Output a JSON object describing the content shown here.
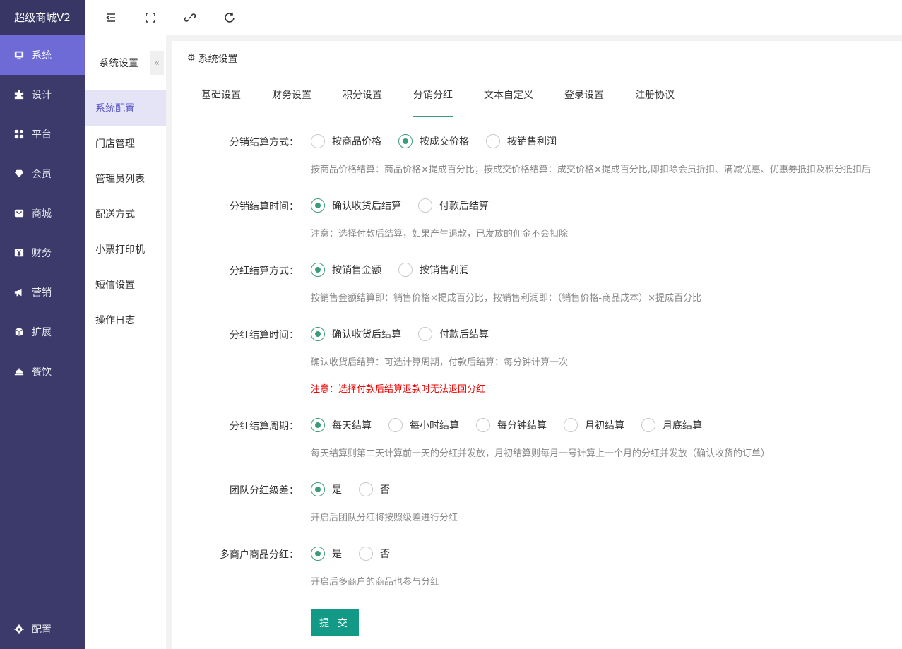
{
  "app": {
    "brand": "超级商城V2"
  },
  "sidebar": {
    "items": [
      {
        "label": "系统",
        "icon": "monitor-icon"
      },
      {
        "label": "设计",
        "icon": "puzzle-icon"
      },
      {
        "label": "平台",
        "icon": "grid-icon"
      },
      {
        "label": "会员",
        "icon": "diamond-icon"
      },
      {
        "label": "商城",
        "icon": "cart-icon"
      },
      {
        "label": "财务",
        "icon": "yen-icon"
      },
      {
        "label": "营销",
        "icon": "megaphone-icon"
      },
      {
        "label": "扩展",
        "icon": "cube-icon"
      },
      {
        "label": "餐饮",
        "icon": "dish-icon"
      }
    ],
    "bottom": {
      "label": "配置",
      "icon": "gear-icon"
    },
    "active_index": 0
  },
  "topbar": {
    "icons": [
      "menu-fold-icon",
      "fullscreen-icon",
      "link-icon",
      "refresh-icon"
    ]
  },
  "submenu": {
    "title": "系统设置",
    "collapse": "«",
    "items": [
      "系统配置",
      "门店管理",
      "管理员列表",
      "配送方式",
      "小票打印机",
      "短信设置",
      "操作日志"
    ],
    "active_index": 0
  },
  "panel": {
    "title": "系统设置",
    "tabs": [
      "基础设置",
      "财务设置",
      "积分设置",
      "分销分红",
      "文本自定义",
      "登录设置",
      "注册协议"
    ],
    "active_tab": 3
  },
  "form": {
    "rows": [
      {
        "label": "分销结算方式：",
        "options": [
          "按商品价格",
          "按成交价格",
          "按销售利润"
        ],
        "selected": 1,
        "hint": "按商品价格结算：商品价格×提成百分比；按成交价格结算：成交价格×提成百分比,即扣除会员折扣、满减优惠、优惠券抵扣及积分抵扣后"
      },
      {
        "label": "分销结算时间：",
        "options": [
          "确认收货后结算",
          "付款后结算"
        ],
        "selected": 0,
        "hint": "注意：选择付款后结算，如果产生退款，已发放的佣金不会扣除"
      },
      {
        "label": "分红结算方式：",
        "options": [
          "按销售金额",
          "按销售利润"
        ],
        "selected": 0,
        "hint": "按销售金额结算即：销售价格×提成百分比，按销售利润即：（销售价格-商品成本）×提成百分比"
      },
      {
        "label": "分红结算时间：",
        "options": [
          "确认收货后结算",
          "付款后结算"
        ],
        "selected": 0,
        "hint": "确认收货后结算：可选计算周期，付款后结算：每分钟计算一次",
        "warning": "注意：选择付款后结算退款时无法退回分红"
      },
      {
        "label": "分红结算周期：",
        "options": [
          "每天结算",
          "每小时结算",
          "每分钟结算",
          "月初结算",
          "月底结算"
        ],
        "selected": 0,
        "hint": "每天结算则第二天计算前一天的分红并发放，月初结算则每月一号计算上一个月的分红并发放（确认收货的订单）"
      },
      {
        "label": "团队分红级差：",
        "options": [
          "是",
          "否"
        ],
        "selected": 0,
        "hint": "开启后团队分红将按照级差进行分红"
      },
      {
        "label": "多商户商品分红：",
        "options": [
          "是",
          "否"
        ],
        "selected": 0,
        "hint": "开启后多商户的商品也参与分红"
      }
    ],
    "submit_label": "提 交"
  },
  "colors": {
    "accent": "#3d9b7c",
    "sidebar_bg": "#3b3a6b",
    "sidebar_active": "#6e6bd6",
    "submit_bg": "#129a86",
    "warning": "#ee0000"
  }
}
